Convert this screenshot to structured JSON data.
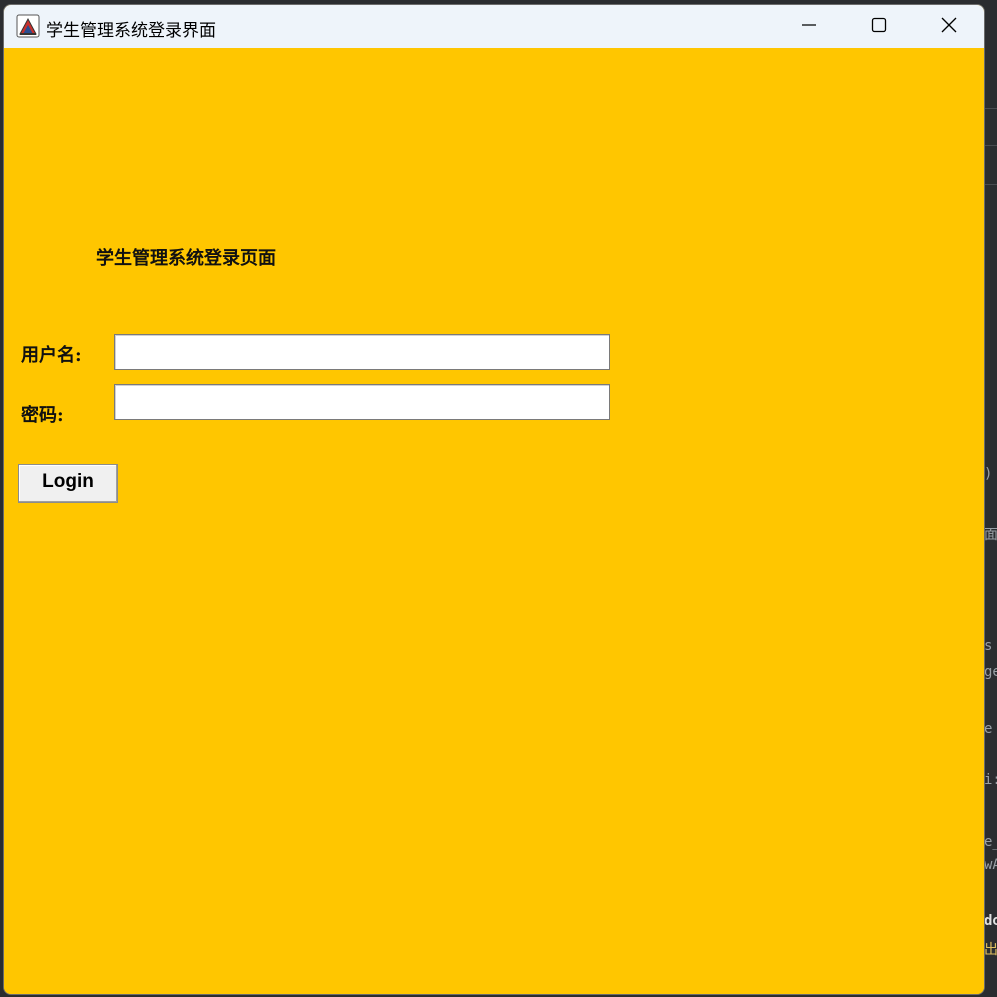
{
  "window": {
    "title": "学生管理系统登录界面",
    "background_color": "#ffc600",
    "titlebar_color": "#eef4fa"
  },
  "form": {
    "heading": "学生管理系统登录页面",
    "username_label": "用户名:",
    "username_value": "",
    "password_label": "密码:",
    "password_value": "",
    "login_button": "Login"
  },
  "background_fragments": {
    "right": [
      ")",
      "面\"",
      "s",
      "ge",
      "e",
      "i:",
      "e_",
      "wA",
      "do",
      "出"
    ]
  },
  "icons": {
    "app": "java-cup-icon",
    "minimize": "minimize-icon",
    "maximize": "maximize-icon",
    "close": "close-icon"
  }
}
